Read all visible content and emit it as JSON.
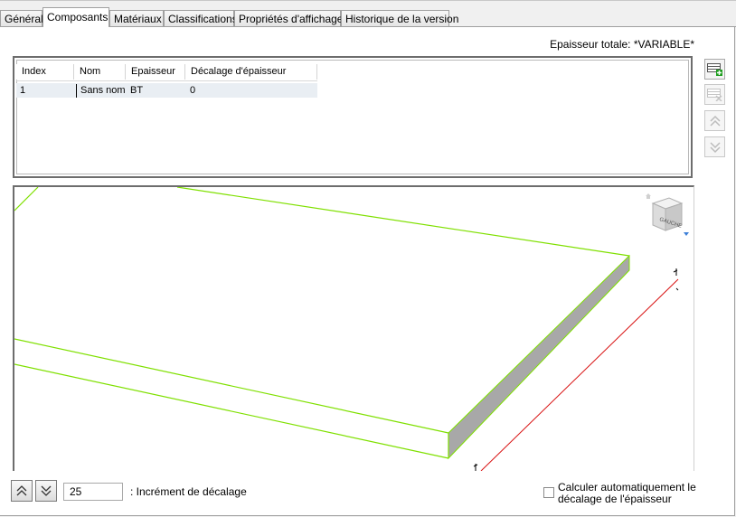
{
  "tabs": [
    {
      "label": "Général",
      "active": false
    },
    {
      "label": "Composants",
      "active": true
    },
    {
      "label": "Matériaux",
      "active": false
    },
    {
      "label": "Classifications",
      "active": false
    },
    {
      "label": "Propriétés d'affichage",
      "active": false
    },
    {
      "label": "Historique de la version",
      "active": false
    }
  ],
  "total_thickness": "Epaisseur totale: *VARIABLE*",
  "table": {
    "columns": [
      "Index",
      "Nom",
      "Epaisseur",
      "Décalage d'épaisseur"
    ],
    "rows": [
      {
        "index": "1",
        "nom": "Sans nom",
        "epaisseur": "BT",
        "decalage": "0"
      }
    ]
  },
  "side_buttons": [
    {
      "icon": "add-component-icon",
      "enabled": true
    },
    {
      "icon": "remove-component-icon",
      "enabled": false
    },
    {
      "icon": "move-up-icon",
      "enabled": false
    },
    {
      "icon": "move-down-icon",
      "enabled": false
    }
  ],
  "viewcube": {
    "face_label": "GAUCHE"
  },
  "increment": {
    "value": "25",
    "label": ": Incrément de décalage"
  },
  "auto_offset": {
    "checked": false,
    "label": "Calculer automatiquement le décalage de l'épaisseur"
  },
  "colors": {
    "edge_green": "#7fe000",
    "side_gray": "#a8a8a8",
    "ref_red": "#d81010"
  }
}
